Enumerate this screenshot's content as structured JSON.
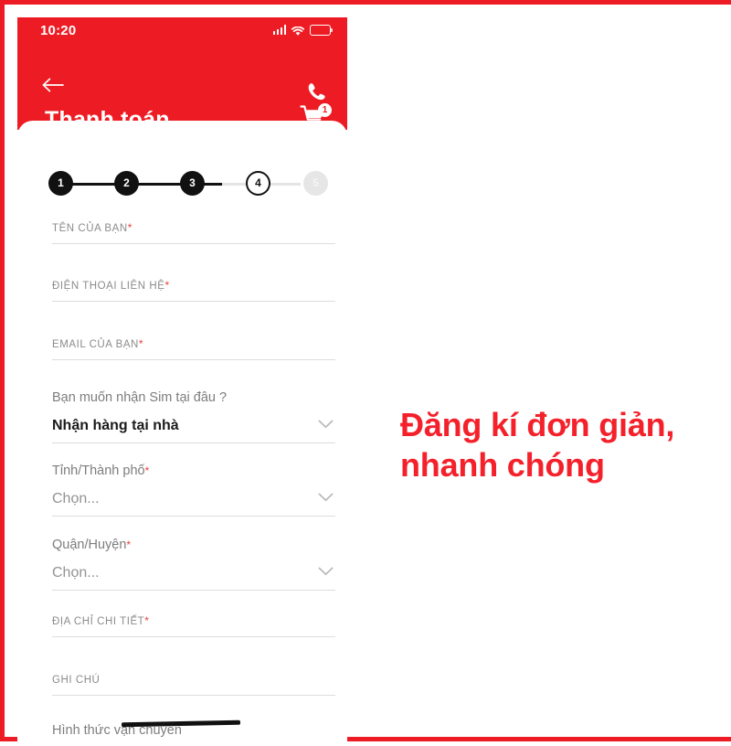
{
  "frame": {
    "accent_color": "#ED1C24"
  },
  "phone": {
    "statusbar": {
      "time": "10:20",
      "icons": [
        "signal-bars-icon",
        "wifi-icon",
        "battery-icon"
      ],
      "battery_color": "#FFCC00"
    },
    "header": {
      "back_icon": "back-arrow-icon",
      "title": "Thanh toán",
      "phone_icon": "phone-call-icon",
      "cart_icon": "shopping-cart-icon",
      "cart_badge": "1",
      "background_color": "#ED1C24"
    },
    "stepper": {
      "steps": [
        {
          "label": "1",
          "state": "done"
        },
        {
          "label": "2",
          "state": "done"
        },
        {
          "label": "3",
          "state": "done"
        },
        {
          "label": "4",
          "state": "current"
        },
        {
          "label": "5",
          "state": "todo"
        }
      ],
      "done_color": "#111111",
      "todo_color": "#e4e4e4"
    },
    "form": {
      "fields": [
        {
          "label": "TÊN CỦA BẠN",
          "required": true,
          "style": "caps",
          "value": "",
          "placeholder": ""
        },
        {
          "label": "ĐIỆN THOẠI LIÊN HỆ",
          "required": true,
          "style": "caps",
          "value": "",
          "placeholder": ""
        },
        {
          "label": "EMAIL CỦA BẠN",
          "required": true,
          "style": "caps",
          "value": "",
          "placeholder": ""
        },
        {
          "label": "Bạn muốn nhận Sim tại đâu ?",
          "required": false,
          "style": "select",
          "value": "Nhận hàng tại nhà",
          "placeholder": ""
        },
        {
          "label": "Tỉnh/Thành phố",
          "required": true,
          "style": "select",
          "value": "",
          "placeholder": "Chọn..."
        },
        {
          "label": "Quận/Huyện",
          "required": true,
          "style": "select",
          "value": "",
          "placeholder": "Chọn..."
        },
        {
          "label": "ĐỊA CHỈ CHI TIẾT",
          "required": true,
          "style": "caps",
          "value": "",
          "placeholder": ""
        },
        {
          "label": "GHI CHÚ",
          "required": false,
          "style": "caps",
          "value": "",
          "placeholder": ""
        },
        {
          "label": "Hình thức vận chuyển",
          "required": false,
          "style": "plain",
          "value": "",
          "placeholder": ""
        }
      ],
      "required_marker": "*",
      "required_color": "#E8413B",
      "chevron_icon": "chevron-down-icon"
    }
  },
  "caption": {
    "line1": "Đăng kí đơn giản,",
    "line2": "nhanh chóng",
    "color": "#F4212B"
  }
}
